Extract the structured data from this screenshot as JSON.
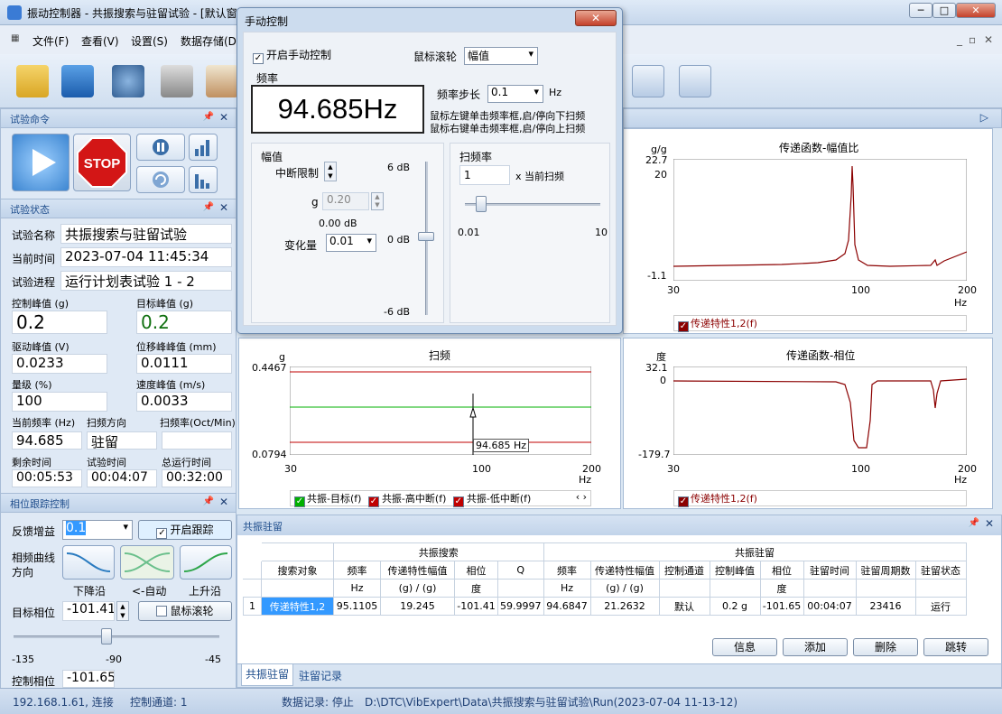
{
  "window": {
    "title": "振动控制器 - 共振搜索与驻留试验 - [默认窗"
  },
  "menu": [
    "文件(F)",
    "查看(V)",
    "设置(S)",
    "数据存储(D)"
  ],
  "panels": {
    "cmd": {
      "title": "试验命令"
    },
    "state": {
      "title": "试验状态",
      "name_label": "试验名称",
      "name": "共振搜索与驻留试验",
      "time_label": "当前时间",
      "time": "2023-07-04 11:45:34",
      "progress_label": "试验进程",
      "progress": "运行计划表试验 1 - 2",
      "ctrl_peak_label": "控制峰值 (g)",
      "ctrl_peak": "0.2",
      "target_peak_label": "目标峰值 (g)",
      "target_peak": "0.2",
      "drive_peak_label": "驱动峰值 (V)",
      "drive_peak": "0.0233",
      "disp_peak_label": "位移峰峰值 (mm)",
      "disp_peak": "0.0111",
      "level_label": "量级 (%)",
      "level": "100",
      "vel_peak_label": "速度峰值 (m/s)",
      "vel_peak": "0.0033",
      "freq_label": "当前频率 (Hz)",
      "freq": "94.685",
      "dir_label": "扫频方向",
      "dir": "驻留",
      "rate_label": "扫频率(Oct/Min)",
      "rate": "",
      "remain_label": "剩余时间",
      "remain": "00:05:53",
      "elapsed_label": "试验时间",
      "elapsed": "00:04:07",
      "total_label": "总运行时间",
      "total": "00:32:00"
    },
    "phase": {
      "title": "相位跟踪控制",
      "gain_label": "反馈增益",
      "gain": "0.1",
      "track_label": "开启跟踪",
      "curve_label": "相频曲线方向",
      "down": "下降沿",
      "auto": "<-自动",
      "up": "上升沿",
      "target_label": "目标相位",
      "target": "-101.41",
      "wheel_label": "鼠标滚轮",
      "tick_a": "-135",
      "tick_b": "-90",
      "tick_c": "-45",
      "slider": 0.45,
      "ctrl_label": "控制相位",
      "ctrl": "-101.65"
    }
  },
  "dialog": {
    "title": "手动控制",
    "enable_label": "开启手动控制",
    "wheel_label": "鼠标滚轮",
    "wheel_value": "幅值",
    "freq_group": "频率",
    "freq_value": "94.685Hz",
    "step_label": "频率步长",
    "step_value": "0.1",
    "step_unit": "Hz",
    "hint1": "鼠标左键单击频率框,启/停向下扫频",
    "hint2": "鼠标右键单击频率框,启/停向上扫频",
    "amp_group": "幅值",
    "abort_label": "中断限制",
    "g_label": "g",
    "g_value": "0.20",
    "db_value": "0.00 dB",
    "change_label": "变化量",
    "change_value": "0.01",
    "db_top": "6 dB",
    "db_mid": "0 dB",
    "db_bot": "-6 dB",
    "rate_group": "扫频率",
    "rate_value": "1",
    "rate_unit": "x 当前扫频",
    "rate_min": "0.01",
    "rate_max": "10"
  },
  "charts": {
    "mag": {
      "title": "传递函数-幅值比",
      "unit": "g/g",
      "y_top": "22.7",
      "y_20": "20",
      "y_bot": "-1.1",
      "x0": "30",
      "x1": "100",
      "x2": "200",
      "xunit": "Hz",
      "legend": "传递特性1,2(f)"
    },
    "phase": {
      "title": "传递函数-相位",
      "unit": "度",
      "y_top": "32.1",
      "y_0": "0",
      "y_bot": "-179.7",
      "x0": "30",
      "x1": "100",
      "x2": "200",
      "xunit": "Hz",
      "legend": "传递特性1,2(f)"
    },
    "sweep": {
      "title": "扫频",
      "unit": "g",
      "y_top": "0.4467",
      "y_bot": "0.0794",
      "x0": "30",
      "x1": "100",
      "x2": "200",
      "xunit": "Hz",
      "marker": "94.685 Hz",
      "legend1": "共振-目标(f)",
      "legend2": "共振-高中断(f)",
      "legend3": "共振-低中断(f)"
    }
  },
  "resonance": {
    "title": "共振驻留",
    "group_search": "共振搜索",
    "group_dwell": "共振驻留",
    "headers": [
      "搜索对象",
      "频率",
      "传递特性幅值",
      "相位",
      "Q",
      "频率",
      "传递特性幅值",
      "控制通道",
      "控制峰值",
      "相位",
      "驻留时间",
      "驻留周期数",
      "驻留状态"
    ],
    "units": [
      "",
      "Hz",
      "(g) / (g)",
      "度",
      "",
      "Hz",
      "(g) / (g)",
      "",
      "",
      "度",
      "",
      "",
      ""
    ],
    "row": [
      "1",
      "传递特性1,2",
      "95.1105",
      "19.245",
      "-101.41",
      "59.9997",
      "94.6847",
      "21.2632",
      "默认",
      "0.2 g",
      "-101.65",
      "00:04:07",
      "23416",
      "运行"
    ],
    "buttons": [
      "信息",
      "添加",
      "删除",
      "跳转"
    ],
    "tab1": "共振驻留",
    "tab2": "驻留记录"
  },
  "status": {
    "ip": "192.168.1.61, 连接",
    "channel": "控制通道: 1",
    "record": "数据记录: 停止",
    "path": "D:\\DTC\\VibExpert\\Data\\共振搜索与驻留试验\\Run(2023-07-04 11-13-12)"
  },
  "colors": {
    "accent": "#1e4d8c",
    "curve": "#8b0000",
    "green": "#00b000",
    "red": "#c00000"
  }
}
